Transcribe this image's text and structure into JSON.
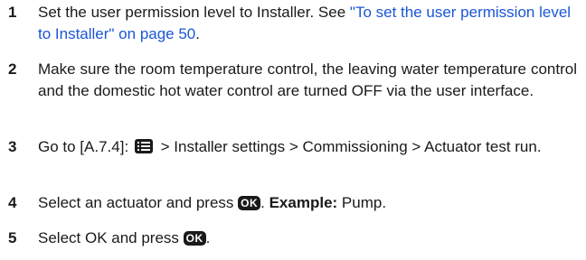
{
  "steps": [
    {
      "number": "1",
      "text_before": "Set the user permission level to Installer. See ",
      "link": "\"To set the user permission level to Installer\" on page 50",
      "text_after": "."
    },
    {
      "number": "2",
      "text": "Make sure the room temperature control, the leaving water temperature control and the domestic hot water control are turned OFF via the user interface."
    },
    {
      "number": "3",
      "text_before": "Go to [A.7.4]: ",
      "icon": "menu-icon",
      "text_after": " > Installer settings > Commissioning > Actuator test run."
    },
    {
      "number": "4",
      "text_before": "Select an actuator and press ",
      "button": "OK",
      "text_middle": ". ",
      "bold_label": "Example:",
      "text_after": " Pump."
    },
    {
      "number": "5",
      "text_before": "Select OK and press ",
      "button": "OK",
      "text_after": "."
    }
  ],
  "colors": {
    "text": "#1a1a1a",
    "link": "#1a56d6"
  }
}
